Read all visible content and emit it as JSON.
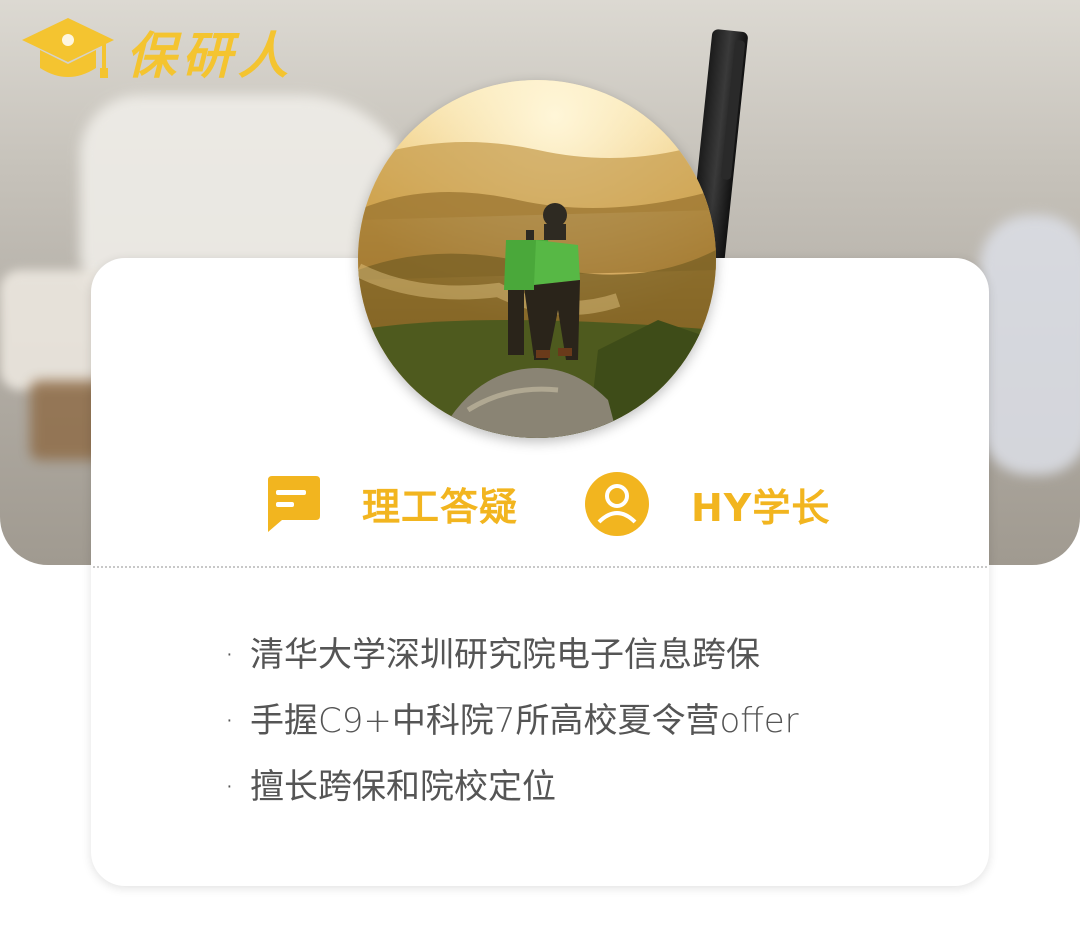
{
  "brand": {
    "name": "保研人",
    "color": "#f4c430"
  },
  "card": {
    "category_label": "理工答疑",
    "category_icon": "chat-bubble-icon",
    "mentor_label": "HY学长",
    "mentor_icon": "user-avatar-icon",
    "accent_color": "#f2b51f"
  },
  "bullets": [
    "清华大学深圳研究院电子信息跨保",
    "手握C9+中科院7所高校夏令营offer",
    "擅长跨保和院校定位"
  ],
  "bullet_marker": "·"
}
